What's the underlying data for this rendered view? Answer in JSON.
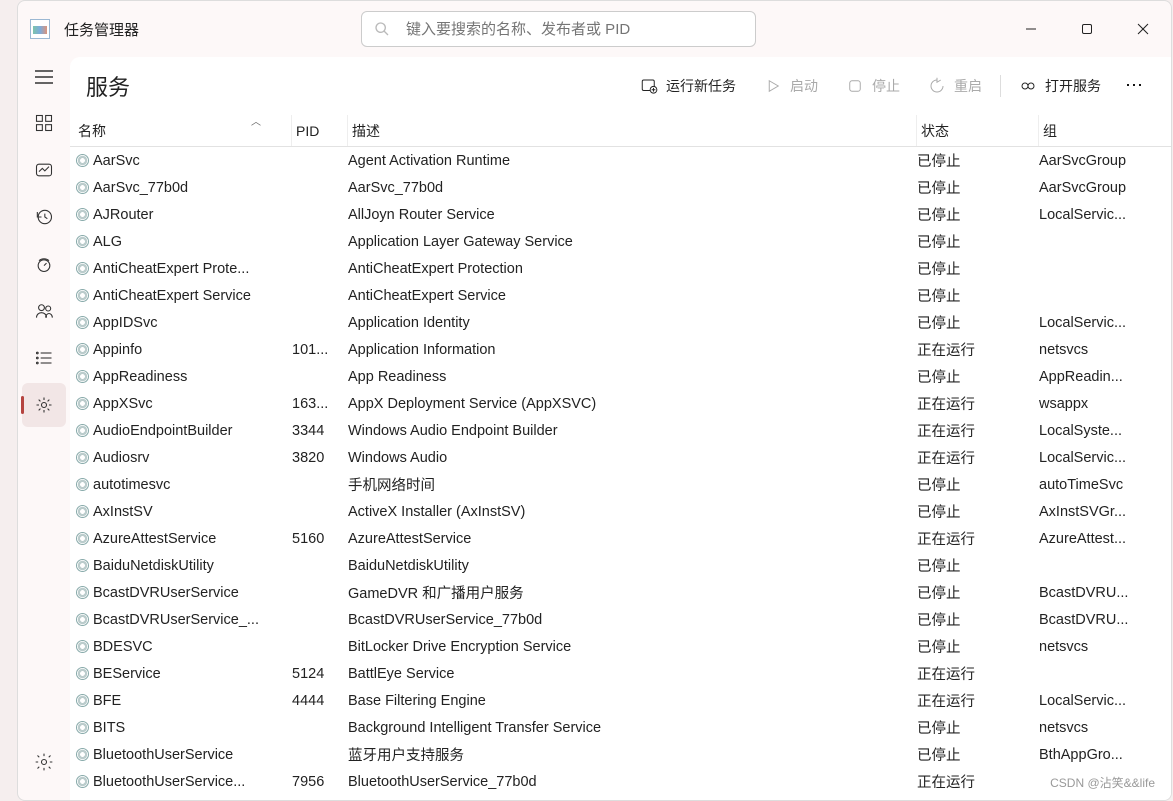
{
  "app_title": "任务管理器",
  "search": {
    "placeholder": "键入要搜索的名称、发布者或 PID"
  },
  "page": {
    "title": "服务"
  },
  "toolbar": {
    "run_task": "运行新任务",
    "start": "启动",
    "stop": "停止",
    "restart": "重启",
    "open_services": "打开服务"
  },
  "columns": {
    "name": "名称",
    "pid": "PID",
    "desc": "描述",
    "status": "状态",
    "group": "组"
  },
  "watermark": "CSDN @沾笑&&life",
  "rows": [
    {
      "name": "AarSvc",
      "pid": "",
      "desc": "Agent Activation Runtime",
      "status": "已停止",
      "group": "AarSvcGroup"
    },
    {
      "name": "AarSvc_77b0d",
      "pid": "",
      "desc": "AarSvc_77b0d",
      "status": "已停止",
      "group": "AarSvcGroup"
    },
    {
      "name": "AJRouter",
      "pid": "",
      "desc": "AllJoyn Router Service",
      "status": "已停止",
      "group": "LocalServic..."
    },
    {
      "name": "ALG",
      "pid": "",
      "desc": "Application Layer Gateway Service",
      "status": "已停止",
      "group": ""
    },
    {
      "name": "AntiCheatExpert Prote...",
      "pid": "",
      "desc": "AntiCheatExpert Protection",
      "status": "已停止",
      "group": ""
    },
    {
      "name": "AntiCheatExpert Service",
      "pid": "",
      "desc": "AntiCheatExpert Service",
      "status": "已停止",
      "group": ""
    },
    {
      "name": "AppIDSvc",
      "pid": "",
      "desc": "Application Identity",
      "status": "已停止",
      "group": "LocalServic..."
    },
    {
      "name": "Appinfo",
      "pid": "101...",
      "desc": "Application Information",
      "status": "正在运行",
      "group": "netsvcs"
    },
    {
      "name": "AppReadiness",
      "pid": "",
      "desc": "App Readiness",
      "status": "已停止",
      "group": "AppReadin..."
    },
    {
      "name": "AppXSvc",
      "pid": "163...",
      "desc": "AppX Deployment Service (AppXSVC)",
      "status": "正在运行",
      "group": "wsappx"
    },
    {
      "name": "AudioEndpointBuilder",
      "pid": "3344",
      "desc": "Windows Audio Endpoint Builder",
      "status": "正在运行",
      "group": "LocalSyste..."
    },
    {
      "name": "Audiosrv",
      "pid": "3820",
      "desc": "Windows Audio",
      "status": "正在运行",
      "group": "LocalServic..."
    },
    {
      "name": "autotimesvc",
      "pid": "",
      "desc": "手机网络时间",
      "status": "已停止",
      "group": "autoTimeSvc"
    },
    {
      "name": "AxInstSV",
      "pid": "",
      "desc": "ActiveX Installer (AxInstSV)",
      "status": "已停止",
      "group": "AxInstSVGr..."
    },
    {
      "name": "AzureAttestService",
      "pid": "5160",
      "desc": "AzureAttestService",
      "status": "正在运行",
      "group": "AzureAttest..."
    },
    {
      "name": "BaiduNetdiskUtility",
      "pid": "",
      "desc": "BaiduNetdiskUtility",
      "status": "已停止",
      "group": ""
    },
    {
      "name": "BcastDVRUserService",
      "pid": "",
      "desc": "GameDVR 和广播用户服务",
      "status": "已停止",
      "group": "BcastDVRU..."
    },
    {
      "name": "BcastDVRUserService_...",
      "pid": "",
      "desc": "BcastDVRUserService_77b0d",
      "status": "已停止",
      "group": "BcastDVRU..."
    },
    {
      "name": "BDESVC",
      "pid": "",
      "desc": "BitLocker Drive Encryption Service",
      "status": "已停止",
      "group": "netsvcs"
    },
    {
      "name": "BEService",
      "pid": "5124",
      "desc": "BattlEye Service",
      "status": "正在运行",
      "group": ""
    },
    {
      "name": "BFE",
      "pid": "4444",
      "desc": "Base Filtering Engine",
      "status": "正在运行",
      "group": "LocalServic..."
    },
    {
      "name": "BITS",
      "pid": "",
      "desc": "Background Intelligent Transfer Service",
      "status": "已停止",
      "group": "netsvcs"
    },
    {
      "name": "BluetoothUserService",
      "pid": "",
      "desc": "蓝牙用户支持服务",
      "status": "已停止",
      "group": "BthAppGro..."
    },
    {
      "name": "BluetoothUserService...",
      "pid": "7956",
      "desc": "BluetoothUserService_77b0d",
      "status": "正在运行",
      "group": ""
    }
  ]
}
